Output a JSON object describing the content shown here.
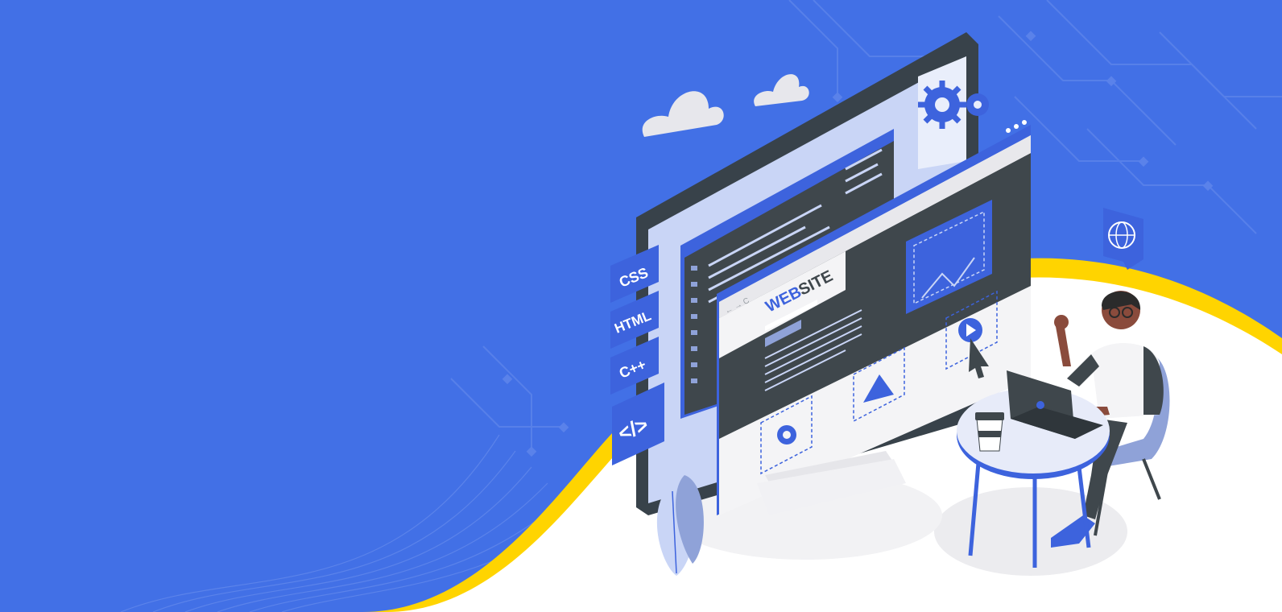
{
  "scene": {
    "background_color": "#4270e6",
    "accent_yellow": "#ffd400",
    "ground_color": "#ffffff",
    "monitor_dark": "#3f474c",
    "accent_blue": "#3d63dd"
  },
  "language_tags": [
    "CSS",
    "HTML",
    "C++"
  ],
  "code_icon_label": "</>",
  "website": {
    "title_bold": "WEB",
    "title_rest": "SITE",
    "nav_text": "← → C",
    "close_mark": "x"
  },
  "icons": [
    "cloud-icon",
    "gear-icon",
    "globe-icon",
    "image-icon",
    "play-icon",
    "cursor-icon",
    "coffee-cup-icon",
    "laptop-icon",
    "leaf-plant-icon"
  ]
}
